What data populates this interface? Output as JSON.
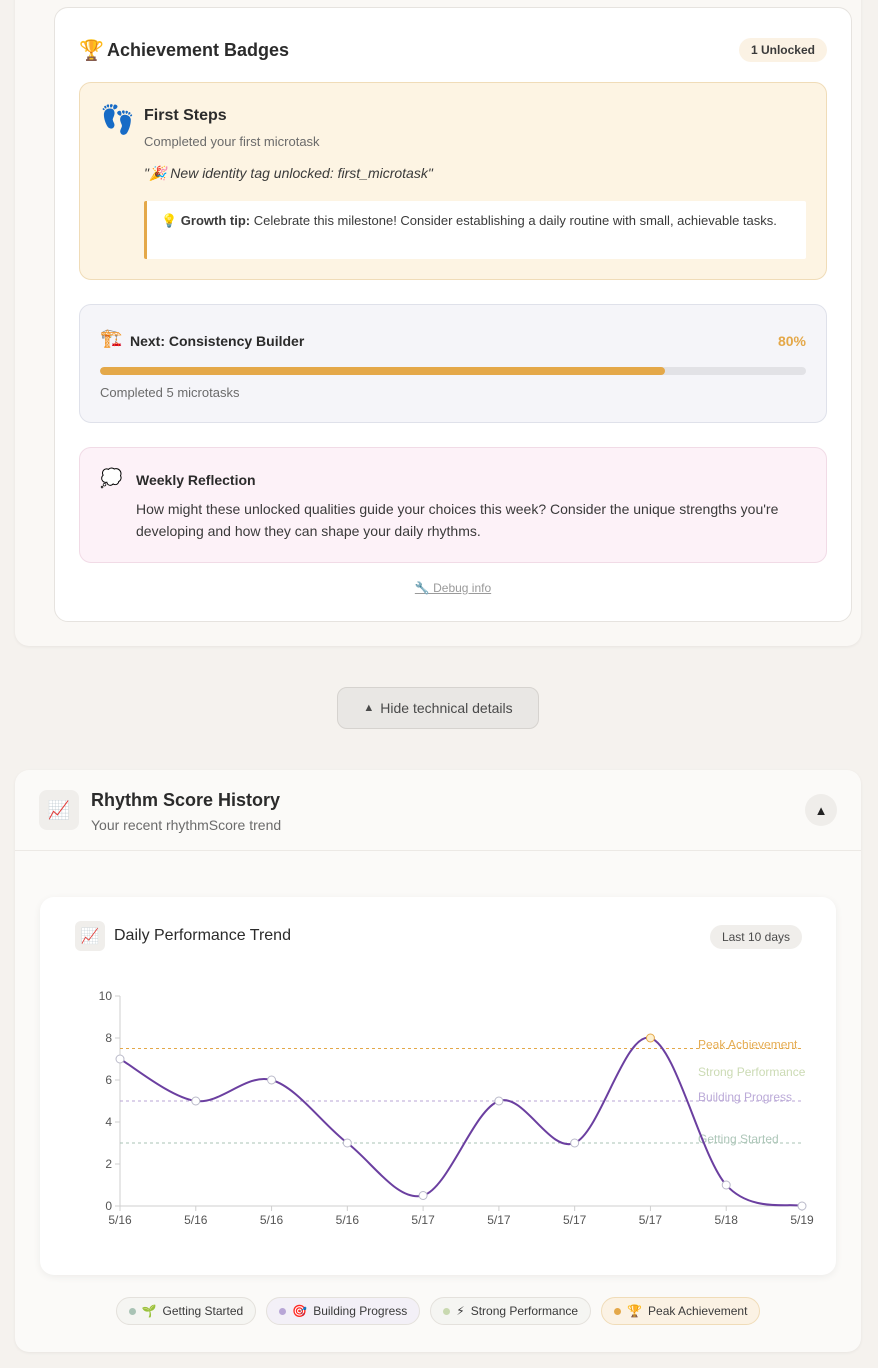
{
  "badges": {
    "trophy_icon": "🏆",
    "title": "Achievement Badges",
    "unlocked_count": "1 Unlocked",
    "first_badge": {
      "icon": "👣",
      "name": "First Steps",
      "description": "Completed your first microtask",
      "quote": "\"🎉 New identity tag unlocked: first_microtask\"",
      "tip_label": "💡 Growth tip:",
      "tip_text": " Celebrate this milestone! Consider establishing a daily routine with small, achievable tasks."
    },
    "next": {
      "icon": "🏗️",
      "label": "Next: Consistency Builder",
      "percent": "80%",
      "progress": 0.8,
      "subtext": "Completed 5 microtasks"
    },
    "reflection": {
      "icon": "💭",
      "title": "Weekly Reflection",
      "text": "How might these unlocked qualities guide your choices this week? Consider the unique strengths you're developing and how they can shape your daily rhythms."
    },
    "debug_link": "🔧 Debug info"
  },
  "toggle_button": {
    "arrow": "▲",
    "label": "Hide technical details"
  },
  "history": {
    "icon": "📈",
    "title": "Rhythm Score History",
    "subtitle": "Your recent rhythmScore trend",
    "collapse_icon": "▲"
  },
  "chart_card": {
    "icon": "📈",
    "title": "Daily Performance Trend",
    "range": "Last 10 days"
  },
  "legend": [
    {
      "icon": "🌱",
      "label": "Getting Started",
      "color": "#a9c3b5"
    },
    {
      "icon": "🎯",
      "label": "Building Progress",
      "color": "#b8a6d6"
    },
    {
      "icon": "⚡",
      "label": "Strong Performance",
      "color": "#c9d9b0"
    },
    {
      "icon": "🏆",
      "label": "Peak Achievement",
      "color": "#e4a849"
    }
  ],
  "colors": {
    "accent": "#e4a849",
    "line": "#6b3fa0"
  },
  "chart_data": {
    "type": "line",
    "title": "",
    "xlabel": "",
    "ylabel": "",
    "x": [
      "5/16",
      "5/16",
      "5/16",
      "5/16",
      "5/17",
      "5/17",
      "5/17",
      "5/17",
      "5/18",
      "5/19"
    ],
    "series": [
      {
        "values": [
          7,
          5,
          6,
          3,
          0.5,
          5,
          3,
          8,
          1,
          0
        ]
      }
    ],
    "ylim": [
      0,
      10
    ],
    "yticks": [
      0,
      2,
      4,
      6,
      8,
      10
    ],
    "grid": false,
    "reference_lines": [
      {
        "label": "Peak Achievement",
        "value": 7.5,
        "color": "#e4a849"
      },
      {
        "label": "Strong Performance",
        "value": 6.2,
        "color": "#c9d9b0"
      },
      {
        "label": "Building Progress",
        "value": 5,
        "color": "#b8a6d6"
      },
      {
        "label": "Getting Started",
        "value": 3,
        "color": "#a9c3b5"
      }
    ]
  }
}
